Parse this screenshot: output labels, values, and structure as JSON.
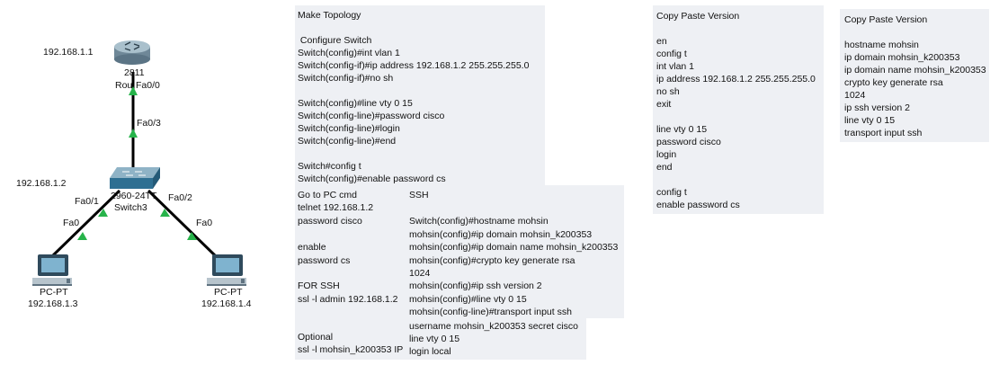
{
  "topology": {
    "router": {
      "model": "2811",
      "name": "Rou",
      "ip": "192.168.1.1",
      "port": "Fa0/0"
    },
    "switch": {
      "model": "2960-24TT",
      "name": "Switch3",
      "ip": "192.168.1.2",
      "uplink_port": "Fa0/3",
      "port_left": "Fa0/1",
      "port_right": "Fa0/2"
    },
    "pc_left": {
      "name": "PC-PT",
      "ip": "192.168.1.3",
      "port": "Fa0"
    },
    "pc_right": {
      "name": "PC-PT",
      "ip": "192.168.1.4",
      "port": "Fa0"
    },
    "colors": {
      "link": "#000000",
      "link_up": "#27b34a",
      "device": "#2e6f92"
    }
  },
  "notes": {
    "make_topology": [
      "Make Topology",
      "",
      " Configure Switch",
      "Switch(config)#int vlan 1",
      "Switch(config-if)#ip address 192.168.1.2 255.255.255.0",
      "Switch(config-if)#no sh",
      "",
      "Switch(config)#line vty 0 15",
      "Switch(config-line)#password cisco",
      "Switch(config-line)#login",
      "Switch(config-line)#end",
      "",
      "Switch#config t",
      "Switch(config)#enable password cs"
    ],
    "pc_cmd": [
      "Go to PC cmd",
      "telnet 192.168.1.2",
      "password cisco",
      "",
      "enable",
      "password cs",
      "",
      "FOR SSH",
      "ssl -l admin 192.168.1.2"
    ],
    "ssh": [
      "SSH",
      "",
      "Switch(config)#hostname mohsin",
      "mohsin(config)#ip domain mohsin_k200353",
      "mohsin(config)#ip domain name mohsin_k200353",
      "mohsin(config)#crypto key generate rsa",
      "1024",
      "mohsin(config)#ip ssh version 2",
      "mohsin(config)#line vty 0 15",
      "mohsin(config-line)#transport input ssh"
    ],
    "optional_left": [
      "Optional",
      "ssl -l mohsin_k200353 IP"
    ],
    "optional_right": [
      "username mohsin_k200353 secret cisco",
      "line vty 0 15",
      "login local"
    ],
    "copy_paste_1": [
      "Copy Paste Version",
      "",
      "en",
      "config t",
      "int vlan 1",
      "ip address 192.168.1.2 255.255.255.0",
      "no sh",
      "exit",
      "",
      "line vty 0 15",
      "password cisco",
      "login",
      "end",
      "",
      "config t",
      "enable password cs"
    ],
    "copy_paste_2": [
      "Copy Paste Version",
      "",
      "hostname mohsin",
      "ip domain mohsin_k200353",
      "ip domain name mohsin_k200353",
      "crypto key generate rsa",
      "1024",
      "ip ssh version 2",
      "line vty 0 15",
      "transport input ssh"
    ]
  }
}
